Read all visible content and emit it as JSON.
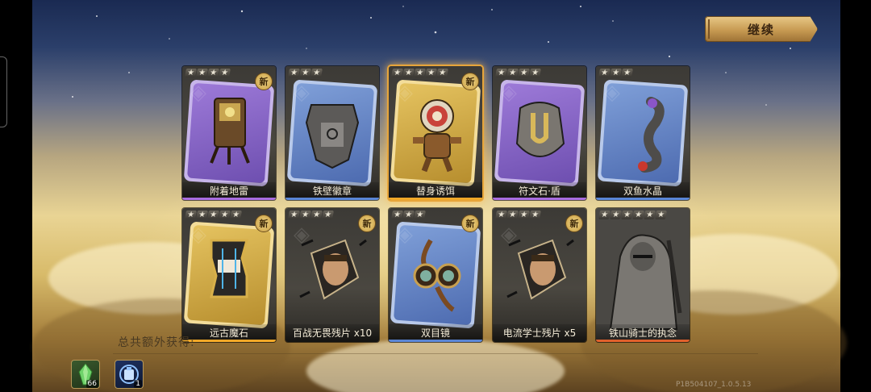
{
  "continue_label": "继续",
  "cards": [
    {
      "name": "附着地雷",
      "stars": 4,
      "is_new": true,
      "new_label": "新",
      "frame": "purple",
      "icon": "mine-icon"
    },
    {
      "name": "铁壁徽章",
      "stars": 3,
      "is_new": false,
      "frame": "blue",
      "icon": "badge-icon"
    },
    {
      "name": "替身诱饵",
      "stars": 5,
      "is_new": true,
      "new_label": "新",
      "frame": "gold",
      "icon": "decoy-icon",
      "highlighted": true
    },
    {
      "name": "符文石·盾",
      "stars": 4,
      "is_new": false,
      "frame": "purple",
      "icon": "rune-shield-icon"
    },
    {
      "name": "双鱼水晶",
      "stars": 3,
      "is_new": false,
      "frame": "blue",
      "icon": "crystal-icon"
    },
    {
      "name": "远古魔石",
      "stars": 5,
      "is_new": true,
      "new_label": "新",
      "frame": "gold",
      "icon": "magic-stone-icon"
    },
    {
      "name": "百战无畏残片 x10",
      "stars": 4,
      "is_new": true,
      "new_label": "新",
      "frame": "fragment",
      "icon": "hero-fragment-icon"
    },
    {
      "name": "双目镜",
      "stars": 3,
      "is_new": true,
      "new_label": "新",
      "frame": "blue",
      "icon": "goggles-icon"
    },
    {
      "name": "电流学士残片 x5",
      "stars": 4,
      "is_new": true,
      "new_label": "新",
      "frame": "fragment",
      "icon": "hero-fragment-icon"
    },
    {
      "name": "铁山骑士的执念",
      "stars": 6,
      "is_new": false,
      "frame": "red",
      "icon": "knight-portrait-icon"
    }
  ],
  "bonus_label": "总共额外获得:",
  "bonus_items": [
    {
      "icon": "green-crystal-icon",
      "count": "66"
    },
    {
      "icon": "blue-emblem-icon",
      "count": "1"
    }
  ],
  "version_text": "P1B504107_1.0.5.13"
}
